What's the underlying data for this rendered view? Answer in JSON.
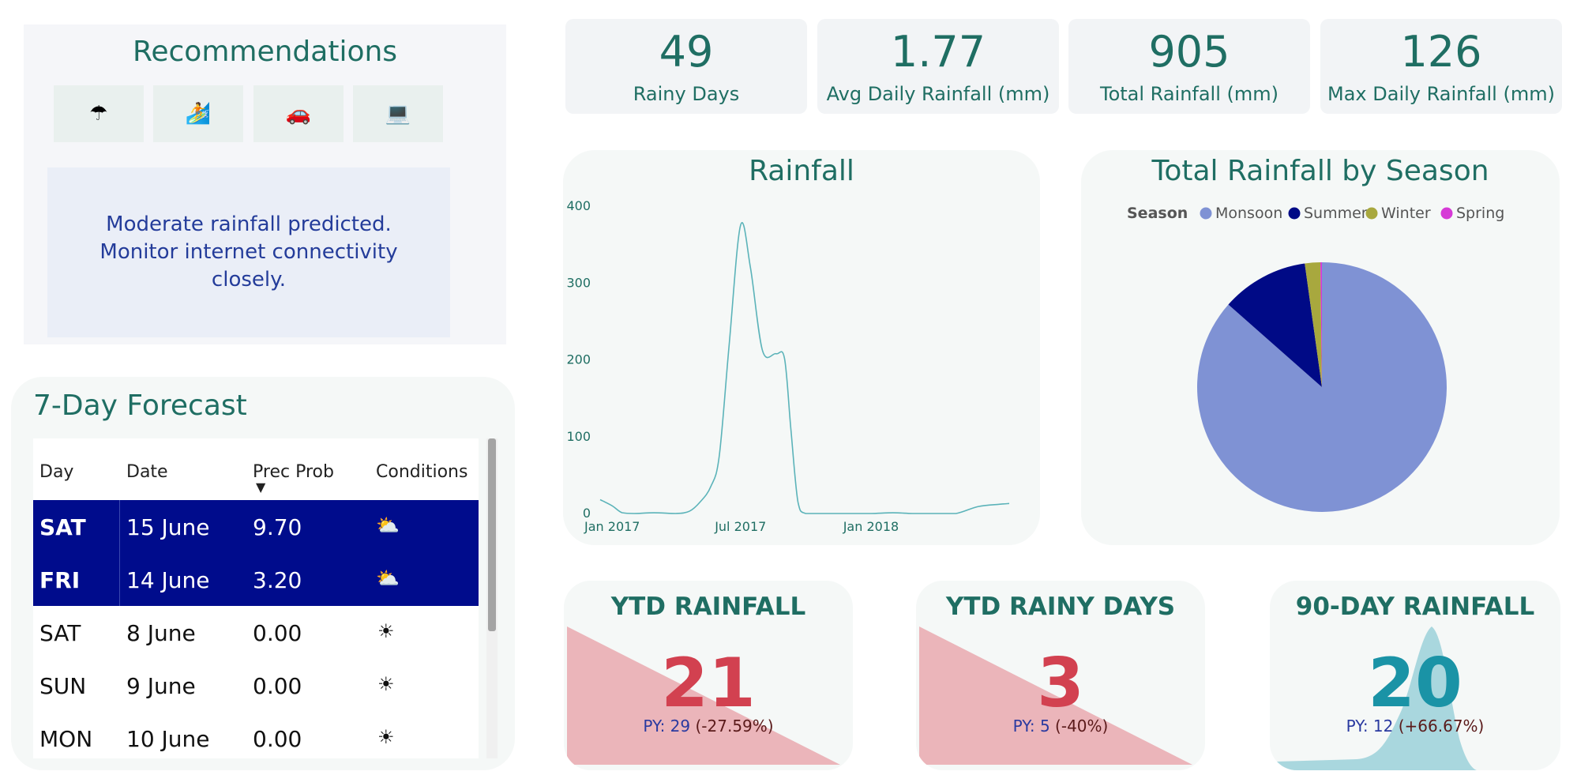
{
  "recommendations": {
    "title": "Recommendations",
    "tiles": [
      {
        "icon": "umbrella-icon",
        "glyph": "☂"
      },
      {
        "icon": "surfer-icon",
        "glyph": "🏄"
      },
      {
        "icon": "car-icon",
        "glyph": "🚗"
      },
      {
        "icon": "laptop-worker-icon",
        "glyph": "💻"
      }
    ],
    "message": "Moderate rainfall predicted. Monitor internet connectivity closely."
  },
  "kpis": [
    {
      "value": "49",
      "label": "Rainy Days"
    },
    {
      "value": "1.77",
      "label": "Avg Daily Rainfall (mm)"
    },
    {
      "value": "905",
      "label": "Total Rainfall (mm)"
    },
    {
      "value": "126",
      "label": "Max Daily Rainfall (mm)"
    }
  ],
  "forecast": {
    "title": "7-Day Forecast",
    "columns": [
      "Day",
      "Date",
      "Prec Prob",
      "Conditions"
    ],
    "sort_indicator": "▼",
    "rows": [
      {
        "day": "SAT",
        "date": "15 June",
        "prob": "9.70",
        "cond": "⛅",
        "cond_icon": "partly-cloudy-icon",
        "selected": true
      },
      {
        "day": "FRI",
        "date": "14 June",
        "prob": "3.20",
        "cond": "⛅",
        "cond_icon": "partly-cloudy-icon",
        "selected": true
      },
      {
        "day": "SAT",
        "date": "8 June",
        "prob": "0.00",
        "cond": "☀",
        "cond_icon": "sun-icon",
        "selected": false
      },
      {
        "day": "SUN",
        "date": "9 June",
        "prob": "0.00",
        "cond": "☀",
        "cond_icon": "sun-icon",
        "selected": false
      },
      {
        "day": "MON",
        "date": "10 June",
        "prob": "0.00",
        "cond": "☀",
        "cond_icon": "sun-icon",
        "selected": false
      }
    ]
  },
  "chart_data": [
    {
      "type": "line",
      "title": "Rainfall",
      "xlabel": "",
      "ylabel": "",
      "x_ticks": [
        "Jan 2017",
        "Jul 2017",
        "Jan 2018"
      ],
      "yticks": [
        0,
        100,
        200,
        300,
        400
      ],
      "ylim": [
        0,
        400
      ],
      "color": "#5bb3b9",
      "x": [
        "2016-12-15",
        "2017-01-01",
        "2017-01-15",
        "2017-02-01",
        "2017-03-01",
        "2017-04-01",
        "2017-04-20",
        "2017-05-05",
        "2017-05-20",
        "2017-06-01",
        "2017-06-15",
        "2017-07-01",
        "2017-07-15",
        "2017-08-01",
        "2017-08-20",
        "2017-09-01",
        "2017-09-10",
        "2017-09-20",
        "2017-10-01",
        "2017-11-01",
        "2017-12-01",
        "2018-01-01",
        "2018-02-01",
        "2018-03-01",
        "2018-04-01",
        "2018-05-01",
        "2018-06-01",
        "2018-07-01",
        "2018-07-15"
      ],
      "values": [
        18,
        10,
        1,
        0,
        1,
        0,
        3,
        15,
        35,
        75,
        220,
        375,
        320,
        212,
        208,
        202,
        110,
        15,
        0,
        0,
        0,
        0,
        1,
        0,
        0,
        0,
        9,
        12,
        13
      ],
      "grid": false
    },
    {
      "type": "pie",
      "title": "Total Rainfall by Season",
      "legend_title": "Season",
      "legend_position": "top",
      "labels": [
        "Monsoon",
        "Summer",
        "Winter",
        "Spring"
      ],
      "values": [
        86.5,
        11.3,
        2.0,
        0.2
      ],
      "colors": [
        "#7f92d4",
        "#000a86",
        "#a8a83e",
        "#d63ad6"
      ]
    }
  ],
  "ytd_rainfall": {
    "title": "YTD RAINFALL",
    "value": "21",
    "py_label": "PY: 29",
    "change": "(-27.59%)",
    "color": "#d24150"
  },
  "ytd_rainy_days": {
    "title": "YTD RAINY DAYS",
    "value": "3",
    "py_label": "PY: 5",
    "change": "(-40%)",
    "color": "#d24150"
  },
  "rainfall_90": {
    "title": "90-DAY RAINFALL",
    "value": "20",
    "py_label": "PY: 12",
    "change": "(+66.67%)",
    "color": "#1a93a6"
  }
}
